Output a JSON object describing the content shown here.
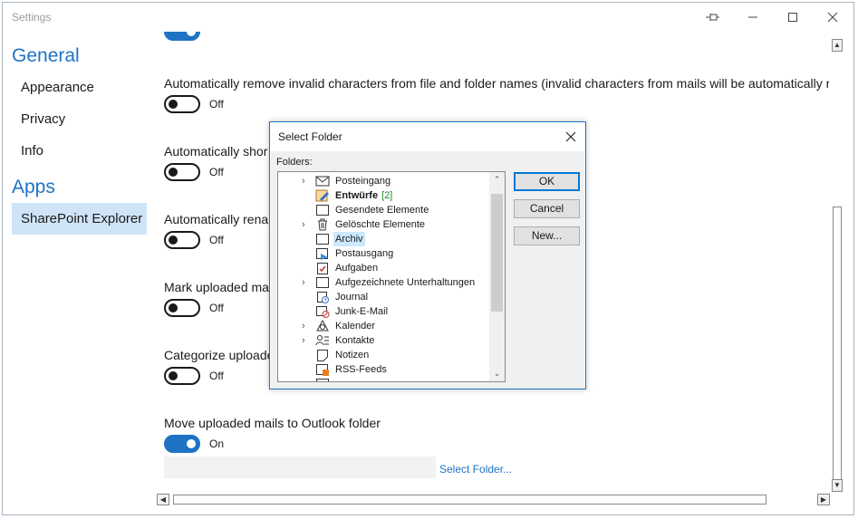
{
  "window": {
    "title": "Settings",
    "buttons": [
      "pin-icon",
      "minimize-icon",
      "maximize-icon",
      "close-icon"
    ]
  },
  "sidebar": {
    "sections": [
      {
        "heading": "General",
        "items": [
          {
            "label": "Appearance",
            "selected": false
          },
          {
            "label": "Privacy",
            "selected": false
          },
          {
            "label": "Info",
            "selected": false
          }
        ]
      },
      {
        "heading": "Apps",
        "items": [
          {
            "label": "SharePoint Explorer",
            "selected": true
          }
        ]
      }
    ]
  },
  "options": [
    {
      "label": "Automatically remove invalid characters from file and folder names (invalid characters from mails will be automatically r",
      "state": "Off"
    },
    {
      "label": "Automatically shor",
      "state": "Off"
    },
    {
      "label": "Automatically rena",
      "state": "Off"
    },
    {
      "label": "Mark uploaded ma",
      "state": "Off"
    },
    {
      "label": "Categorize uploade",
      "state": "Off"
    },
    {
      "label": "Move uploaded mails to Outlook folder",
      "state": "On"
    }
  ],
  "select_folder_link": "Select Folder...",
  "dialog": {
    "title": "Select Folder",
    "folders_label": "Folders:",
    "folders": [
      {
        "label": "Posteingang",
        "icon": "inbox-icon",
        "expandable": true,
        "bold": false,
        "selected": false,
        "count": ""
      },
      {
        "label": "Entwürfe",
        "icon": "drafts-icon",
        "expandable": false,
        "bold": true,
        "selected": false,
        "count": "[2]"
      },
      {
        "label": "Gesendete Elemente",
        "icon": "folder-icon",
        "expandable": false,
        "bold": false,
        "selected": false,
        "count": ""
      },
      {
        "label": "Gelöschte Elemente",
        "icon": "trash-icon",
        "expandable": true,
        "bold": false,
        "selected": false,
        "count": ""
      },
      {
        "label": "Archiv",
        "icon": "folder-icon",
        "expandable": false,
        "bold": false,
        "selected": true,
        "count": ""
      },
      {
        "label": "Postausgang",
        "icon": "outbox-icon",
        "expandable": false,
        "bold": false,
        "selected": false,
        "count": ""
      },
      {
        "label": "Aufgaben",
        "icon": "tasks-icon",
        "expandable": false,
        "bold": false,
        "selected": false,
        "count": ""
      },
      {
        "label": "Aufgezeichnete Unterhaltungen",
        "icon": "folder-icon",
        "expandable": true,
        "bold": false,
        "selected": false,
        "count": ""
      },
      {
        "label": "Journal",
        "icon": "journal-icon",
        "expandable": false,
        "bold": false,
        "selected": false,
        "count": ""
      },
      {
        "label": "Junk-E-Mail",
        "icon": "junk-icon",
        "expandable": false,
        "bold": false,
        "selected": false,
        "count": ""
      },
      {
        "label": "Kalender",
        "icon": "calendar-icon",
        "expandable": true,
        "bold": false,
        "selected": false,
        "count": ""
      },
      {
        "label": "Kontakte",
        "icon": "contacts-icon",
        "expandable": true,
        "bold": false,
        "selected": false,
        "count": ""
      },
      {
        "label": "Notizen",
        "icon": "notes-icon",
        "expandable": false,
        "bold": false,
        "selected": false,
        "count": ""
      },
      {
        "label": "RSS-Feeds",
        "icon": "rss-icon",
        "expandable": false,
        "bold": false,
        "selected": false,
        "count": ""
      }
    ],
    "buttons": {
      "ok": "OK",
      "cancel": "Cancel",
      "new": "New..."
    }
  },
  "colors": {
    "accent": "#1e73c5",
    "selection": "#cfe4f7",
    "tree_selection": "#cce8ff"
  }
}
